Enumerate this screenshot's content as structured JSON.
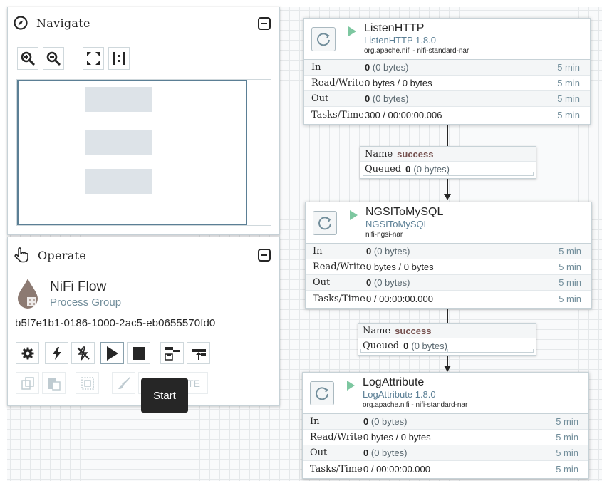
{
  "navigate": {
    "title": "Navigate",
    "tools": [
      "zoom-in",
      "zoom-out",
      "fit",
      "actual-size"
    ]
  },
  "operate": {
    "title": "Operate",
    "flow_name": "NiFi Flow",
    "flow_type": "Process Group",
    "flow_id": "b5f7e1b1-0186-1000-2ac5-eb0655570fd0",
    "delete_label": "DELETE",
    "tooltip": "Start"
  },
  "processors": [
    {
      "name": "ListenHTTP",
      "type": "ListenHTTP 1.8.0",
      "bundle": "org.apache.nifi - nifi-standard-nar",
      "stats": {
        "in_label": "In",
        "in_count": "0",
        "in_bytes": "(0 bytes)",
        "in_time": "5 min",
        "rw_label": "Read/Write",
        "rw_value": "0 bytes / 0 bytes",
        "rw_time": "5 min",
        "out_label": "Out",
        "out_count": "0",
        "out_bytes": "(0 bytes)",
        "out_time": "5 min",
        "tasks_label": "Tasks/Time",
        "tasks_value": "300 / 00:00:00.006",
        "tasks_time": "5 min"
      }
    },
    {
      "name": "NGSIToMySQL",
      "type": "NGSIToMySQL",
      "bundle": "nifi-ngsi-nar",
      "stats": {
        "in_label": "In",
        "in_count": "0",
        "in_bytes": "(0 bytes)",
        "in_time": "5 min",
        "rw_label": "Read/Write",
        "rw_value": "0 bytes / 0 bytes",
        "rw_time": "5 min",
        "out_label": "Out",
        "out_count": "0",
        "out_bytes": "(0 bytes)",
        "out_time": "5 min",
        "tasks_label": "Tasks/Time",
        "tasks_value": "0 / 00:00:00.000",
        "tasks_time": "5 min"
      }
    },
    {
      "name": "LogAttribute",
      "type": "LogAttribute 1.8.0",
      "bundle": "org.apache.nifi - nifi-standard-nar",
      "stats": {
        "in_label": "In",
        "in_count": "0",
        "in_bytes": "(0 bytes)",
        "in_time": "5 min",
        "rw_label": "Read/Write",
        "rw_value": "0 bytes / 0 bytes",
        "rw_time": "5 min",
        "out_label": "Out",
        "out_count": "0",
        "out_bytes": "(0 bytes)",
        "out_time": "5 min",
        "tasks_label": "Tasks/Time",
        "tasks_value": "0 / 00:00:00.000",
        "tasks_time": "5 min"
      }
    }
  ],
  "connections": [
    {
      "name_label": "Name",
      "name": "success",
      "queued_label": "Queued",
      "queued_count": "0",
      "queued_bytes": "(0 bytes)"
    },
    {
      "name_label": "Name",
      "name": "success",
      "queued_label": "Queued",
      "queued_count": "0",
      "queued_bytes": "(0 bytes)"
    }
  ],
  "colors": {
    "canvas": "#f9fafb",
    "run_green": "#7dc7a0",
    "accent_blue": "#5b7f95",
    "conn_name": "#775351"
  }
}
